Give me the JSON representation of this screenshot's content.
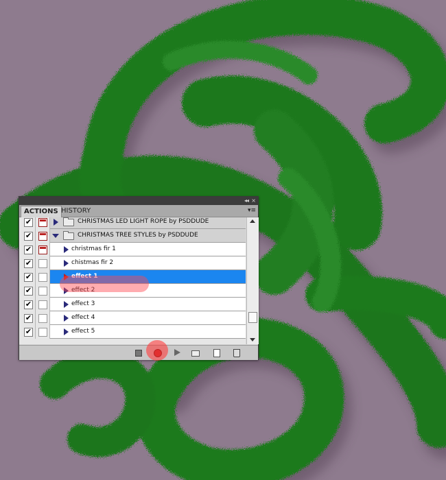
{
  "colors": {
    "background": "#8e7b8e",
    "garland": "#1f7a1f",
    "selection": "#1b86f0",
    "highlight": "#ff4650"
  },
  "panel": {
    "tabs": [
      {
        "label": "ACTIONS"
      },
      {
        "label": "HISTORY"
      }
    ],
    "titlebar": {
      "collapse_icon": "double-chevron-icon",
      "close_icon": "close-icon",
      "arrows": "◂◂",
      "close": "×"
    },
    "menu_icon": "panel-menu-icon",
    "menu_glyph": "▾≡",
    "sets": [
      {
        "name": "CHRISTMAS LED LIGHT ROPE by PSDDUDE",
        "expanded": false,
        "checked": true,
        "dialog": true
      },
      {
        "name": "CHRISTMAS TREE STYLES by PSDDUDE",
        "expanded": true,
        "checked": true,
        "dialog": true
      }
    ],
    "actions": [
      {
        "name": "christmas fir 1",
        "checked": true,
        "dialog": true,
        "selected": false
      },
      {
        "name": "chistmas fir 2",
        "checked": true,
        "dialog": false,
        "selected": false
      },
      {
        "name": "effect 1",
        "checked": true,
        "dialog": false,
        "selected": true
      },
      {
        "name": "effect 2",
        "checked": true,
        "dialog": false,
        "selected": false
      },
      {
        "name": "effect 3",
        "checked": true,
        "dialog": false,
        "selected": false
      },
      {
        "name": "effect 4",
        "checked": true,
        "dialog": false,
        "selected": false
      },
      {
        "name": "effect 5",
        "checked": true,
        "dialog": false,
        "selected": false
      }
    ],
    "bottom_buttons": [
      "stop-icon",
      "record-icon",
      "play-icon",
      "new-set-icon",
      "new-action-icon",
      "trash-icon"
    ]
  }
}
